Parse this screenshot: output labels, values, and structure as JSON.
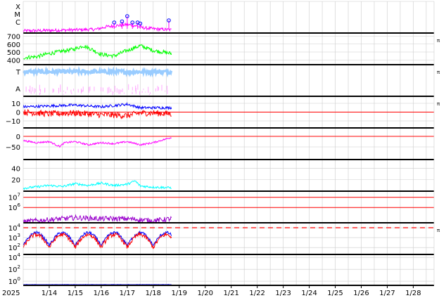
{
  "chart_data": {
    "type": "line",
    "x_axis": {
      "year_label": "2025",
      "start_day": 13,
      "end_day": 28.8,
      "tick_labels": [
        "1/14",
        "1/15",
        "1/16",
        "1/17",
        "1/18",
        "1/19",
        "1/20",
        "1/21",
        "1/22",
        "1/23",
        "1/24",
        "1/25",
        "1/26",
        "1/27",
        "1/28"
      ],
      "tick_days": [
        14,
        15,
        16,
        17,
        18,
        19,
        20,
        21,
        22,
        23,
        24,
        25,
        26,
        27,
        28
      ],
      "data_end_day": 18.7
    },
    "colors": {
      "magenta": "#ff00ff",
      "green": "#00ff00",
      "lightblue": "#99ccff",
      "pink": "#ffaaff",
      "blue": "#0000ff",
      "red": "#ff0000",
      "cyan": "#00ffff",
      "purple": "#9900cc",
      "grid": "#cccccc"
    },
    "panels": [
      {
        "id": "xray-class",
        "labels": [
          "X",
          "M",
          "C"
        ],
        "right_marker": "",
        "ylim": [
          0,
          3
        ],
        "series": [
          {
            "color": "magenta",
            "baseline": 0.2,
            "noise": 0.15,
            "points": [
              [
                13,
                0.2
              ],
              [
                14,
                0.25
              ],
              [
                15,
                0.3
              ],
              [
                15.8,
                0.35
              ],
              [
                16.2,
                0.6
              ],
              [
                16.6,
                0.7
              ],
              [
                17,
                0.8
              ],
              [
                17.3,
                0.7
              ],
              [
                17.6,
                0.5
              ],
              [
                18,
                0.4
              ],
              [
                18.7,
                0.3
              ]
            ]
          }
        ],
        "flare_markers": [
          [
            16.5,
            1.0
          ],
          [
            16.8,
            1.1
          ],
          [
            17.0,
            1.6
          ],
          [
            17.2,
            1.0
          ],
          [
            17.4,
            1.0
          ],
          [
            17.5,
            0.9
          ],
          [
            18.6,
            1.2
          ]
        ]
      },
      {
        "id": "solar-wind-speed",
        "tick_labels": [
          "700",
          "600",
          "500",
          "400"
        ],
        "tick_values": [
          700,
          600,
          500,
          400
        ],
        "right_marker": "π",
        "ylim": [
          340,
          740
        ],
        "series": [
          {
            "color": "green",
            "noise": 25,
            "points": [
              [
                13,
                430
              ],
              [
                13.5,
                440
              ],
              [
                14,
                480
              ],
              [
                14.5,
                510
              ],
              [
                15,
                540
              ],
              [
                15.3,
                580
              ],
              [
                15.6,
                540
              ],
              [
                16,
                470
              ],
              [
                16.5,
                450
              ],
              [
                17,
                520
              ],
              [
                17.5,
                580
              ],
              [
                18,
                520
              ],
              [
                18.7,
                480
              ]
            ]
          }
        ]
      },
      {
        "id": "bz-ta",
        "labels": [
          "T",
          "A"
        ],
        "right_marker": "π",
        "ylim": [
          0,
          4
        ],
        "series": [
          {
            "color": "lightblue",
            "baseline": 3.1,
            "noise": 0.25,
            "points": [
              [
                13,
                3.1
              ],
              [
                18.7,
                3.1
              ]
            ]
          },
          {
            "color": "pink",
            "sparse": true,
            "baseline": 0.6,
            "noise": 0.35,
            "points": [
              [
                13,
                0.5
              ],
              [
                18.7,
                0.5
              ]
            ]
          }
        ]
      },
      {
        "id": "imf",
        "tick_labels": [
          "10",
          "0",
          "−10"
        ],
        "tick_values": [
          10,
          0,
          -10
        ],
        "right_marker": "π",
        "ylim": [
          -18,
          18
        ],
        "ref_line": 0,
        "series": [
          {
            "color": "blue",
            "noise": 1.5,
            "points": [
              [
                13,
                6
              ],
              [
                14,
                7
              ],
              [
                15,
                8
              ],
              [
                16,
                6
              ],
              [
                17,
                9
              ],
              [
                17.5,
                5
              ],
              [
                18,
                5
              ],
              [
                18.7,
                5
              ]
            ]
          },
          {
            "color": "red",
            "noise": 3.5,
            "points": [
              [
                13,
                0
              ],
              [
                14,
                -2
              ],
              [
                15,
                -1
              ],
              [
                16,
                -3
              ],
              [
                17,
                -4
              ],
              [
                17.5,
                -1
              ],
              [
                18,
                -1
              ],
              [
                18.7,
                -2
              ]
            ]
          }
        ]
      },
      {
        "id": "dst",
        "tick_labels": [
          "0",
          "−50"
        ],
        "tick_values": [
          0,
          -50
        ],
        "right_marker": "",
        "ylim": [
          -110,
          40
        ],
        "ref_line": 0,
        "series": [
          {
            "color": "magenta",
            "noise": 4,
            "points": [
              [
                13,
                -20
              ],
              [
                13.5,
                -30
              ],
              [
                14,
                -25
              ],
              [
                14.4,
                -48
              ],
              [
                14.6,
                -30
              ],
              [
                15,
                -25
              ],
              [
                15.5,
                -40
              ],
              [
                16,
                -30
              ],
              [
                16.5,
                -35
              ],
              [
                17,
                -25
              ],
              [
                17.5,
                -40
              ],
              [
                18,
                -30
              ],
              [
                18.7,
                -5
              ]
            ]
          }
        ]
      },
      {
        "id": "kp",
        "tick_labels": [
          "40",
          "20"
        ],
        "tick_values": [
          40,
          20
        ],
        "right_marker": "",
        "ylim": [
          0,
          55
        ],
        "series": [
          {
            "color": "cyan",
            "noise": 2,
            "points": [
              [
                13,
                5
              ],
              [
                14,
                10
              ],
              [
                14.5,
                8
              ],
              [
                15,
                13
              ],
              [
                15.5,
                10
              ],
              [
                16,
                14
              ],
              [
                16.5,
                10
              ],
              [
                17,
                12
              ],
              [
                17.3,
                18
              ],
              [
                17.5,
                9
              ],
              [
                18,
                7
              ],
              [
                18.7,
                6
              ]
            ]
          }
        ]
      },
      {
        "id": "proton",
        "tick_labels": [
          "10^7",
          "10^6"
        ],
        "tick_bases": [
          "10",
          "10"
        ],
        "tick_exps": [
          "7",
          "6"
        ],
        "tick_values": [
          7,
          6
        ],
        "right_marker": "",
        "ylim": [
          4.5,
          7.6
        ],
        "ref_lines": [
          7,
          6
        ],
        "series": [
          {
            "color": "purple",
            "noise": 0.25,
            "points": [
              [
                13,
                4.6
              ],
              [
                14,
                4.8
              ],
              [
                15,
                5.0
              ],
              [
                16,
                4.9
              ],
              [
                17,
                4.9
              ],
              [
                18,
                4.7
              ],
              [
                18.7,
                4.9
              ]
            ]
          }
        ]
      },
      {
        "id": "electron",
        "tick_labels": [
          "10^4",
          "10^3",
          "10^2"
        ],
        "tick_bases": [
          "10",
          "10",
          "10"
        ],
        "tick_exps": [
          "4",
          "3",
          "2"
        ],
        "tick_values": [
          4,
          3,
          2
        ],
        "right_marker": "π",
        "ylim": [
          1.3,
          4.5
        ],
        "ref_line_dashed": 4,
        "series": [
          {
            "color": "blue",
            "noise": 0.15,
            "diurnal": true,
            "points": [
              [
                13,
                2.2
              ],
              [
                18.7,
                2.2
              ]
            ]
          },
          {
            "color": "red",
            "noise": 0.2,
            "diurnal": true,
            "points": [
              [
                13,
                2.0
              ],
              [
                18.7,
                2.0
              ]
            ]
          }
        ]
      },
      {
        "id": "neutron",
        "tick_labels": [
          "10^4",
          "10^2",
          "10^0"
        ],
        "tick_bases": [
          "10",
          "10",
          "10"
        ],
        "tick_exps": [
          "4",
          "2",
          "0"
        ],
        "tick_values": [
          4,
          2,
          0
        ],
        "right_marker": "",
        "ylim": [
          -0.7,
          4.5
        ],
        "series": [
          {
            "color": "blue",
            "noise": 0.05,
            "points": [
              [
                13,
                -0.6
              ],
              [
                18.7,
                -0.6
              ]
            ]
          }
        ]
      }
    ]
  }
}
